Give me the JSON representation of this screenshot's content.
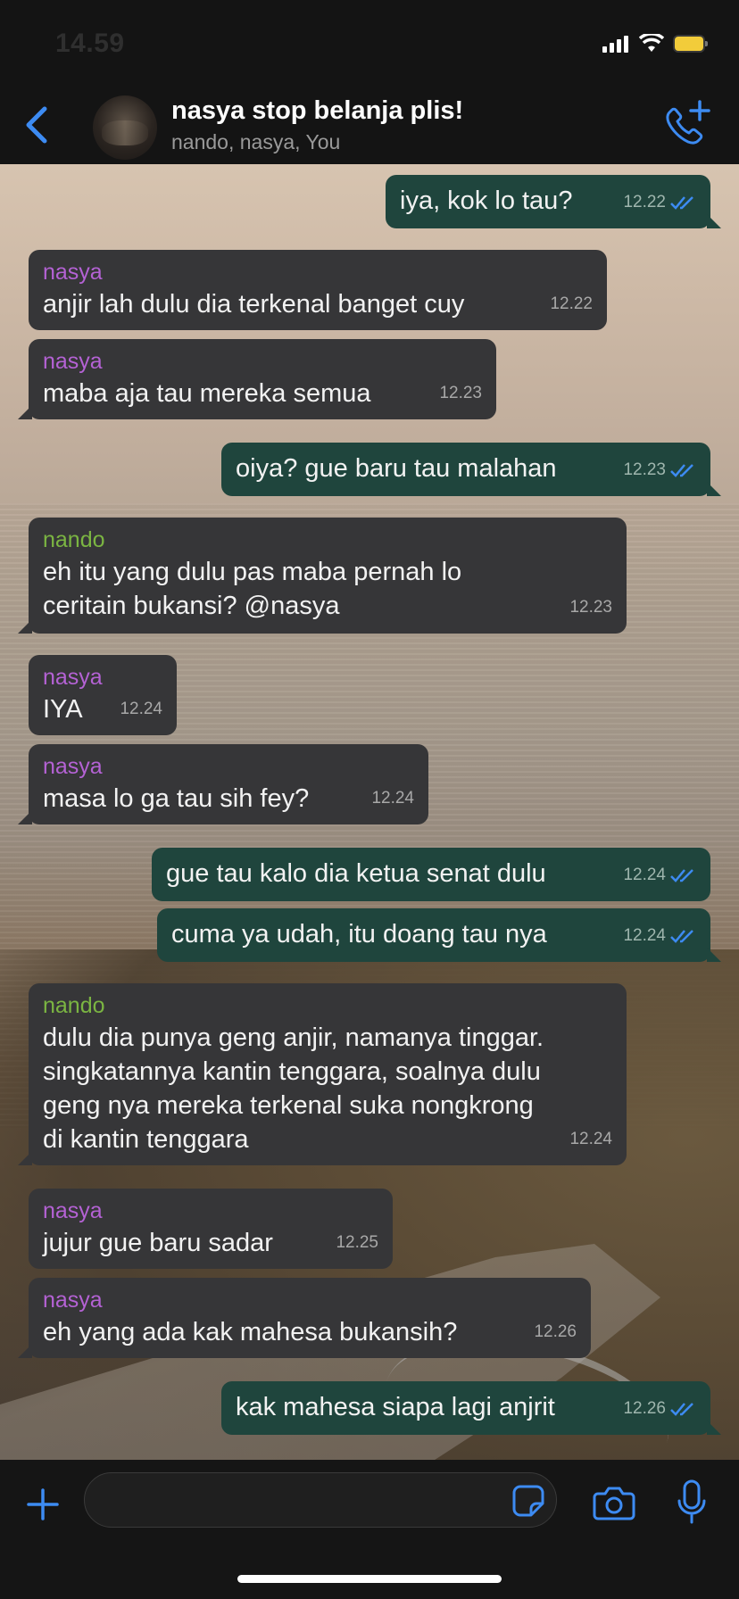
{
  "status_bar": {
    "time": "14.59"
  },
  "header": {
    "title": "nasya stop belanja plis!",
    "members": "nando, nasya, You"
  },
  "icons": {
    "back": "chevron-left-icon",
    "call": "phone-plus-icon",
    "add": "plus-icon",
    "sticker": "sticker-icon",
    "camera": "camera-icon",
    "mic": "microphone-icon"
  },
  "colors": {
    "accent": "#3d8bf2",
    "outgoing_bubble": "#1f453d",
    "incoming_bubble": "#363638",
    "sender_nasya": "#b462d4",
    "sender_nando": "#7bb542"
  },
  "messages": [
    {
      "dir": "out",
      "text": "iya, kok lo tau?",
      "time": "12.22"
    },
    {
      "dir": "in",
      "sender": "nasya",
      "text": "anjir lah dulu dia terkenal banget cuy",
      "time": "12.22"
    },
    {
      "dir": "in",
      "sender": "nasya",
      "text": "maba aja tau mereka semua",
      "time": "12.23"
    },
    {
      "dir": "out",
      "text": "oiya? gue baru tau malahan",
      "time": "12.23"
    },
    {
      "dir": "in",
      "sender": "nando",
      "text_lines": [
        "eh itu yang dulu pas maba pernah lo",
        "ceritain bukansi? @nasya"
      ],
      "time": "12.23"
    },
    {
      "dir": "in",
      "sender": "nasya",
      "text": "IYA",
      "time": "12.24"
    },
    {
      "dir": "in",
      "sender": "nasya",
      "text": "masa lo ga tau sih fey?",
      "time": "12.24"
    },
    {
      "dir": "out",
      "text": "gue tau kalo dia ketua senat dulu",
      "time": "12.24"
    },
    {
      "dir": "out",
      "text": "cuma ya udah, itu doang tau nya",
      "time": "12.24"
    },
    {
      "dir": "in",
      "sender": "nando",
      "text_lines": [
        "dulu dia punya geng anjir, namanya tinggar.",
        "singkatannya kantin tenggara, soalnya dulu",
        "geng nya mereka terkenal suka nongkrong",
        "di kantin tenggara"
      ],
      "time": "12.24"
    },
    {
      "dir": "in",
      "sender": "nasya",
      "text": "jujur gue baru sadar",
      "time": "12.25"
    },
    {
      "dir": "in",
      "sender": "nasya",
      "text": "eh yang ada kak mahesa bukansih?",
      "time": "12.26"
    },
    {
      "dir": "out",
      "text": "kak mahesa siapa lagi anjrit",
      "time": "12.26"
    }
  ]
}
